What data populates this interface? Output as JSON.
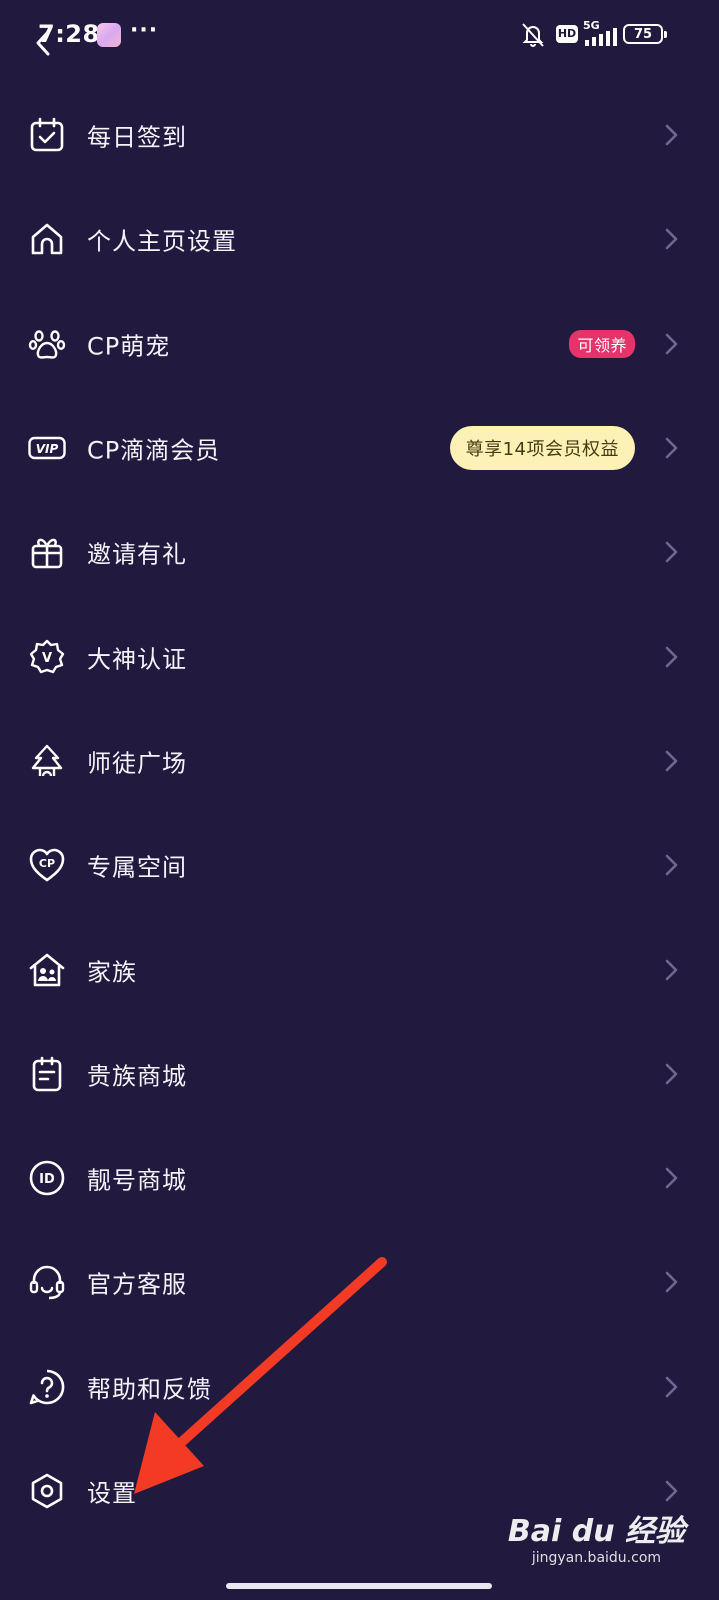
{
  "status_bar": {
    "time": "7:28",
    "more": "···",
    "hd": "HD",
    "network": "5G",
    "battery": "75"
  },
  "menu": {
    "items": [
      {
        "label": "每日签到",
        "icon": "calendar-check-icon"
      },
      {
        "label": "个人主页设置",
        "icon": "home-icon"
      },
      {
        "label": "CP萌宠",
        "icon": "paw-icon",
        "badge": "可领养"
      },
      {
        "label": "CP滴滴会员",
        "icon": "vip-icon",
        "badge": "尊享14项会员权益"
      },
      {
        "label": "邀请有礼",
        "icon": "gift-icon"
      },
      {
        "label": "大神认证",
        "icon": "verified-v-icon"
      },
      {
        "label": "师徒广场",
        "icon": "mentor-icon"
      },
      {
        "label": "专属空间",
        "icon": "cp-heart-icon"
      },
      {
        "label": "家族",
        "icon": "family-house-icon"
      },
      {
        "label": "贵族商城",
        "icon": "clipboard-icon"
      },
      {
        "label": "靓号商城",
        "icon": "id-icon"
      },
      {
        "label": "官方客服",
        "icon": "headset-icon"
      },
      {
        "label": "帮助和反馈",
        "icon": "help-icon"
      },
      {
        "label": "设置",
        "icon": "settings-hexagon-icon"
      }
    ]
  },
  "watermark": {
    "logo": "Bai du 经验",
    "url": "jingyan.baidu.com"
  },
  "colors": {
    "background": "#211a3e",
    "badge_pink": "#e8336a",
    "badge_gold": "#fdf1b6",
    "annotation_arrow": "#f23a24"
  }
}
